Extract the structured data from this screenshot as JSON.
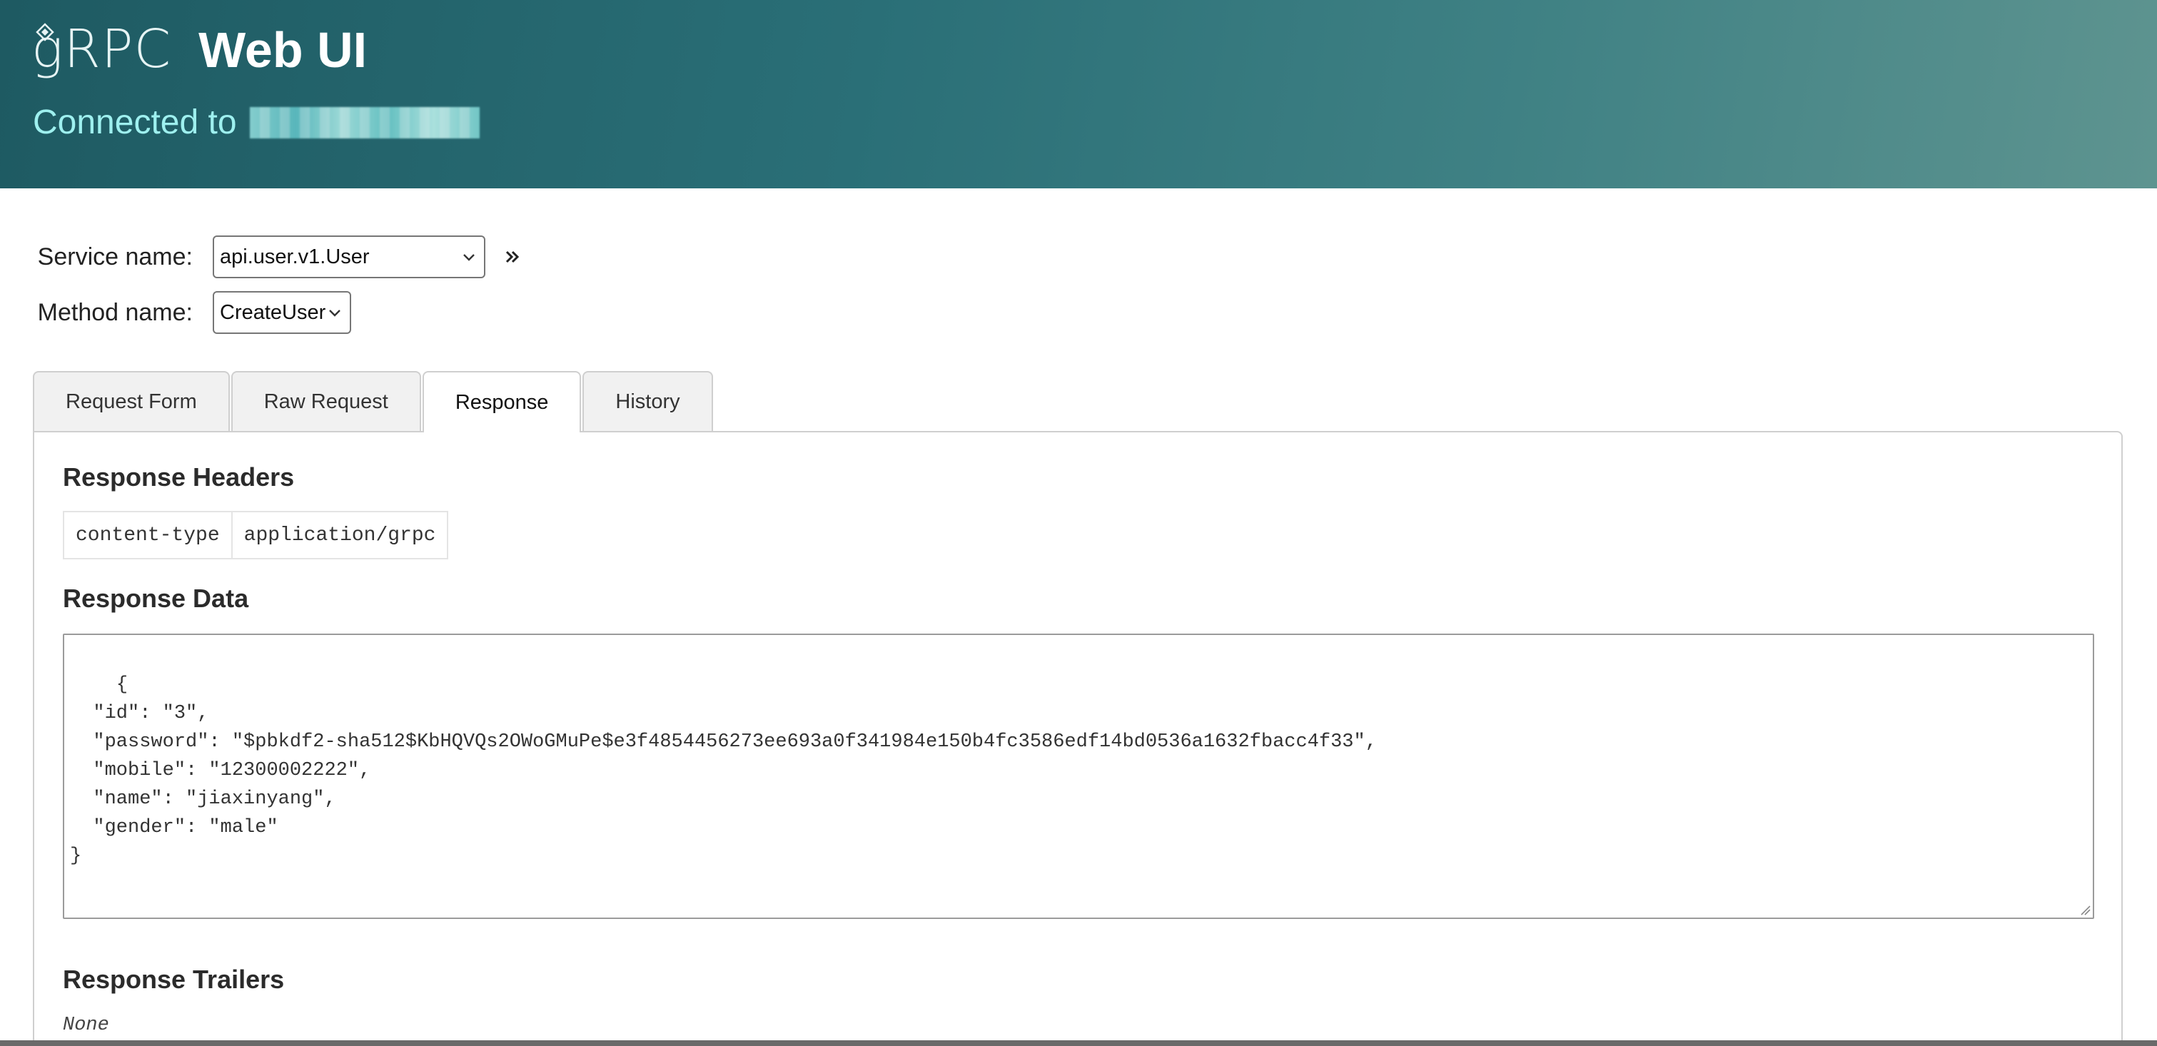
{
  "header": {
    "logo_text": "gRPC",
    "title": "Web UI",
    "connected_label": "Connected to"
  },
  "service": {
    "label": "Service name:",
    "value": "api.user.v1.User"
  },
  "method": {
    "label": "Method name:",
    "value": "CreateUser"
  },
  "tabs": [
    {
      "label": "Request Form",
      "active": false
    },
    {
      "label": "Raw Request",
      "active": false
    },
    {
      "label": "Response",
      "active": true
    },
    {
      "label": "History",
      "active": false
    }
  ],
  "response": {
    "headers_title": "Response Headers",
    "headers": [
      {
        "key": "content-type",
        "value": "application/grpc"
      }
    ],
    "data_title": "Response Data",
    "data_text": "{\n  \"id\": \"3\",\n  \"password\": \"$pbkdf2-sha512$KbHQVQs2OWoGMuPe$e3f4854456273ee693a0f341984e150b4fc3586edf14bd0536a1632fbacc4f33\",\n  \"mobile\": \"12300002222\",\n  \"name\": \"jiaxinyang\",\n  \"gender\": \"male\"\n}",
    "trailers_title": "Response Trailers",
    "trailers_value": "None"
  },
  "icons": {
    "expand": "double-chevron-right-icon",
    "caret": "chevron-down-icon"
  },
  "colors": {
    "header_gradient_start": "#1e5a62",
    "header_gradient_end": "#5e9490",
    "connected_text": "#9ef0ef"
  }
}
